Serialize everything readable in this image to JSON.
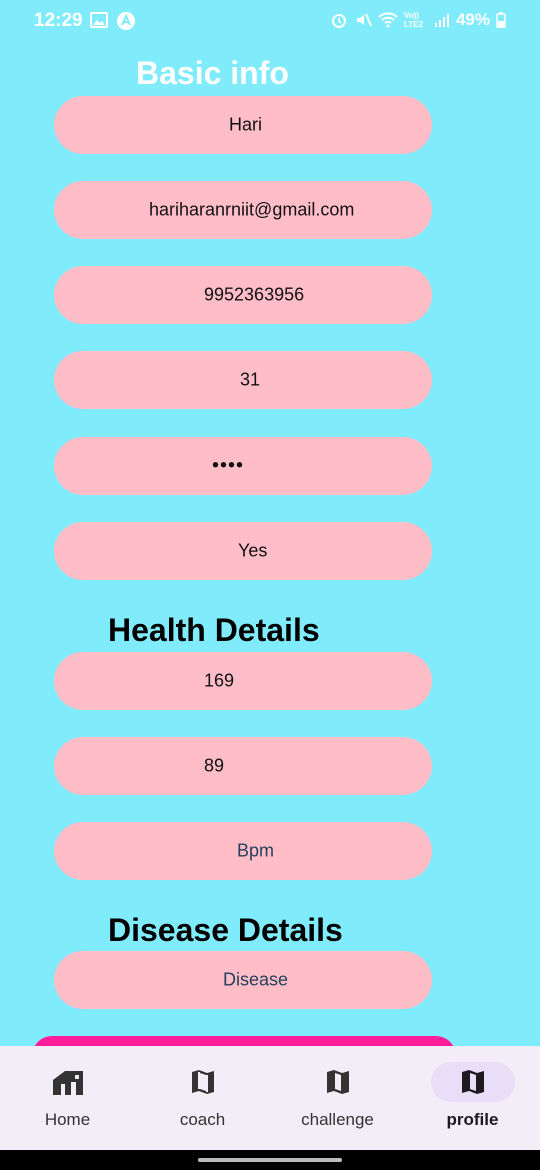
{
  "status_bar": {
    "time": "12:29",
    "network": "Vo)) LTE2",
    "battery": "49%"
  },
  "sections": {
    "basic_title": "Basic info",
    "health_title": "Health Details",
    "disease_title": "Disease Details"
  },
  "fields": {
    "name": "Hari",
    "email": "hariharanrniit@gmail.com",
    "phone": "9952363956",
    "age": "31",
    "password": "••••",
    "answer": "Yes",
    "height": "169",
    "weight": "89",
    "bpm_placeholder": "Bpm",
    "disease_placeholder": "Disease"
  },
  "nav": {
    "items": [
      {
        "label": "Home",
        "icon": "home-icon"
      },
      {
        "label": "coach",
        "icon": "map-icon"
      },
      {
        "label": "challenge",
        "icon": "map-icon"
      },
      {
        "label": "profile",
        "icon": "map-icon"
      }
    ],
    "active": "profile"
  },
  "colors": {
    "background": "#80ECFB",
    "field": "#FFBDC8",
    "button": "#FF1E9A",
    "nav_bg": "#F3EDF7",
    "nav_active": "#E8DEF8"
  }
}
